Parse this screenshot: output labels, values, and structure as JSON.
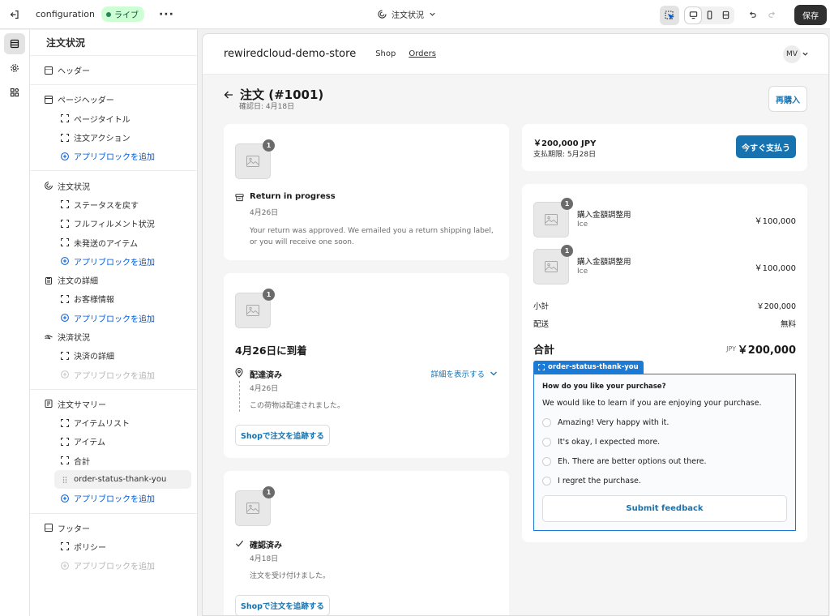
{
  "topbar": {
    "title": "configuration",
    "badge": "ライブ",
    "more": "···",
    "page_selector": "注文状況",
    "save_label": "保存"
  },
  "sidebar": {
    "title": "注文状況",
    "sections": [
      {
        "items": [
          {
            "label": "ヘッダー",
            "icon": "header-layout-icon"
          }
        ]
      },
      {
        "items": [
          {
            "label": "ページヘッダー",
            "icon": "page-header-icon"
          },
          {
            "label": "ページタイトル",
            "icon": "block-icon"
          },
          {
            "label": "注文アクション",
            "icon": "block-icon"
          },
          {
            "label": "アプリブロックを追加",
            "icon": "plus-circle-icon"
          }
        ]
      },
      {
        "items": [
          {
            "label": "注文状況",
            "icon": "status-icon"
          },
          {
            "label": "ステータスを戻す",
            "icon": "block-icon"
          },
          {
            "label": "フルフィルメント状況",
            "icon": "block-icon"
          },
          {
            "label": "未発送のアイテム",
            "icon": "block-icon"
          },
          {
            "label": "アプリブロックを追加",
            "icon": "plus-circle-icon"
          },
          {
            "label": "注文の詳細",
            "icon": "clipboard-icon"
          },
          {
            "label": "お客様情報",
            "icon": "block-icon"
          },
          {
            "label": "アプリブロックを追加",
            "icon": "plus-circle-icon"
          },
          {
            "label": "決済状況",
            "icon": "payment-icon"
          },
          {
            "label": "決済の詳細",
            "icon": "block-icon"
          },
          {
            "label": "アプリブロックを追加",
            "icon": "plus-circle-icon"
          }
        ]
      },
      {
        "items": [
          {
            "label": "注文サマリー",
            "icon": "summary-icon"
          },
          {
            "label": "アイテムリスト",
            "icon": "block-icon"
          },
          {
            "label": "アイテム",
            "icon": "block-icon"
          },
          {
            "label": "合計",
            "icon": "block-icon"
          },
          {
            "label": "order-status-thank-you",
            "icon": "drag-handle-icon"
          },
          {
            "label": "アプリブロックを追加",
            "icon": "plus-circle-icon"
          }
        ]
      },
      {
        "items": [
          {
            "label": "フッター",
            "icon": "footer-layout-icon"
          },
          {
            "label": "ポリシー",
            "icon": "block-icon"
          },
          {
            "label": "アプリブロックを追加",
            "icon": "plus-circle-icon"
          }
        ]
      }
    ]
  },
  "store": {
    "name": "rewiredcloud-demo-store",
    "nav": [
      "Shop",
      "Orders"
    ],
    "avatar": "MV"
  },
  "order": {
    "title": "注文 (#1001)",
    "confirmed": "確認日: 4月18日",
    "rebuy": "再購入"
  },
  "timeline": {
    "return": {
      "qty": "1",
      "title": "Return in progress",
      "date": "4月26日",
      "text1": "Your return was approved. We emailed you a return shipping label,",
      "text2": "or you will receive one soon."
    },
    "arrival": {
      "qty": "1",
      "heading": "4月26日に到着",
      "status": "配達済み",
      "date": "4月26日",
      "details": "詳細を表示する",
      "text": "この荷物は配達されました。",
      "track": "Shopで注文を追跡する"
    },
    "confirmed": {
      "qty": "1",
      "status": "確認済み",
      "date": "4月18日",
      "text": "注文を受け付けました。",
      "track": "Shopで注文を追跡する"
    }
  },
  "payment": {
    "amount": "￥200,000 JPY",
    "due": "支払期限: 5月28日",
    "button": "今すぐ支払う"
  },
  "summary": {
    "items": [
      {
        "qty": "1",
        "name": "購入金額調整用",
        "variant": "Ice",
        "price": "￥100,000"
      },
      {
        "qty": "1",
        "name": "購入金額調整用",
        "variant": "Ice",
        "price": "￥100,000"
      }
    ],
    "subtotal_label": "小計",
    "subtotal": "￥200,000",
    "shipping_label": "配送",
    "shipping": "無料",
    "total_label": "合計",
    "currency": "JPY",
    "total": "￥200,000"
  },
  "survey": {
    "block_tag": "order-status-thank-you",
    "question": "How do you like your purchase?",
    "intro": "We would like to learn if you are enjoying your purchase.",
    "options": [
      "Amazing! Very happy with it.",
      "It's okay, I expected more.",
      "Eh. There are better options out there.",
      "I regret the purchase."
    ],
    "submit": "Submit feedback"
  }
}
